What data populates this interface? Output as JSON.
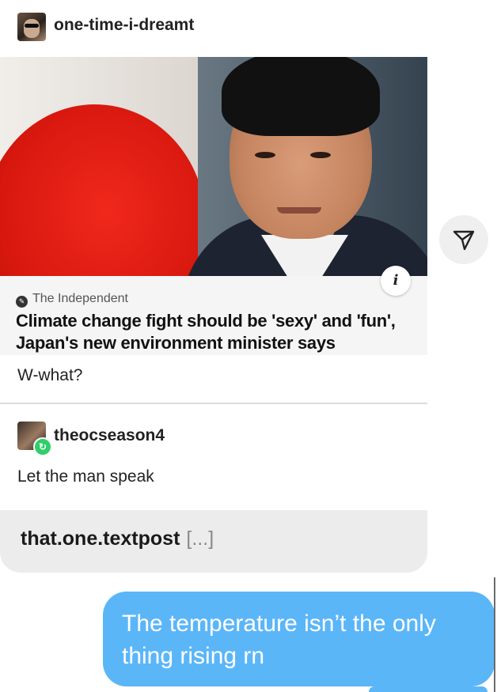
{
  "post": {
    "author": "one-time-i-dreamt",
    "link_card": {
      "source": "The Independent",
      "headline": "Climate change fight should be 'sexy' and 'fun', Japan's new environment minister says",
      "info_icon_glyph": "i"
    },
    "caption": "W-what?",
    "reblog": {
      "author": "theocseason4",
      "comment": "Let the man speak"
    },
    "footer": {
      "author": "that.one.textpost",
      "more": "[...]"
    }
  },
  "message": {
    "text": "The temperature isn’t the only thing rising rn",
    "bubble_color": "#5bb6f8"
  },
  "icons": {
    "share": "paper-plane-icon",
    "info": "info-icon",
    "source": "source-logo-icon",
    "reblog": "reblog-icon"
  }
}
